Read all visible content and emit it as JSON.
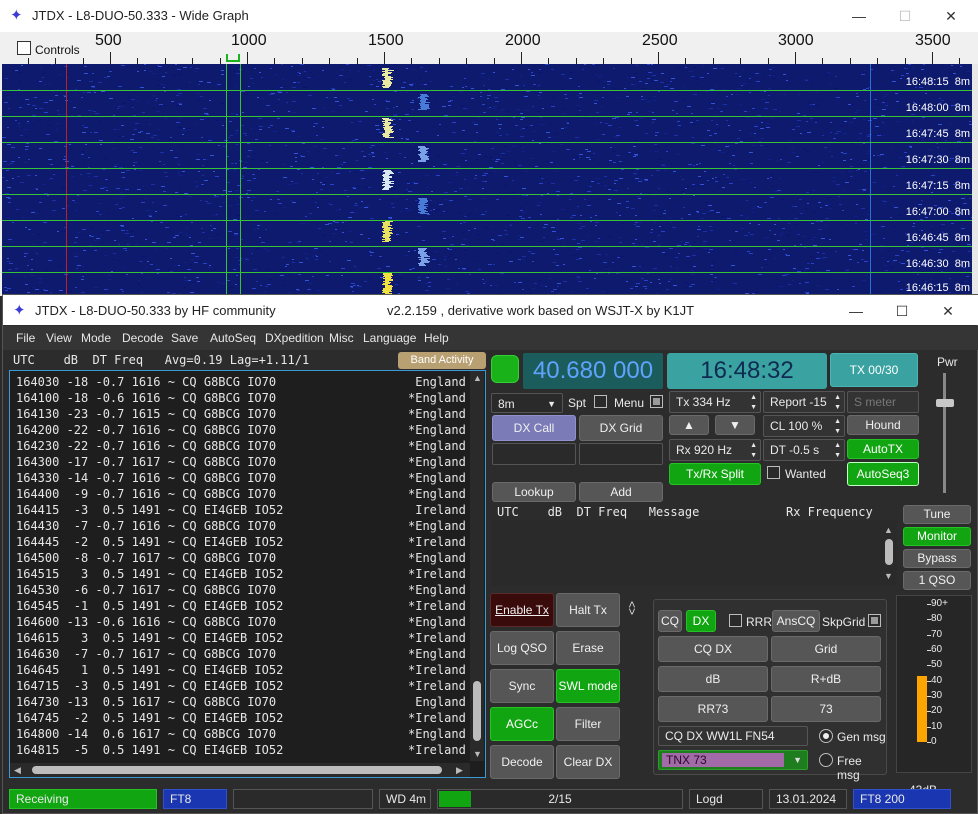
{
  "wide_graph": {
    "title": "JTDX - L8-DUO-50.333 - Wide Graph",
    "controls_label": "Controls",
    "scale_labels": [
      "500",
      "1000",
      "1500",
      "2000",
      "2500",
      "3000",
      "3500"
    ],
    "times": [
      "16:48:15",
      "16:48:00",
      "16:47:45",
      "16:47:30",
      "16:47:15",
      "16:47:00",
      "16:46:45",
      "16:46:30",
      "16:46:15"
    ],
    "band": "8m",
    "win_min": "—",
    "win_max": "☐",
    "win_close": "✕"
  },
  "main": {
    "title": "JTDX - L8-DUO-50.333   by HF community",
    "version": "v2.2.159 , derivative work based on WSJT-X by K1JT",
    "win_min": "—",
    "win_max": "☐",
    "win_close": "✕",
    "menu": [
      "File",
      "View",
      "Mode",
      "Decode",
      "Save",
      "AutoSeq",
      "DXpedition",
      "Misc",
      "Language",
      "Help"
    ]
  },
  "band_activity": {
    "header": "UTC    dB  DT Freq   Avg=0.19 Lag=+1.11/1",
    "button": "Band Activity",
    "rows": [
      {
        "t": "164030 -18 -0.7 1616 ~ CQ G8BCG IO70",
        "c": " England"
      },
      {
        "t": "164100 -18 -0.6 1616 ~ CQ G8BCG IO70",
        "c": "*England"
      },
      {
        "t": "164130 -23 -0.7 1615 ~ CQ G8BCG IO70",
        "c": "*England"
      },
      {
        "t": "164200 -22 -0.7 1616 ~ CQ G8BCG IO70",
        "c": "*England"
      },
      {
        "t": "164230 -22 -0.7 1616 ~ CQ G8BCG IO70",
        "c": "*England"
      },
      {
        "t": "164300 -17 -0.7 1617 ~ CQ G8BCG IO70",
        "c": "*England"
      },
      {
        "t": "164330 -14 -0.7 1616 ~ CQ G8BCG IO70",
        "c": "*England"
      },
      {
        "t": "164400  -9 -0.7 1616 ~ CQ G8BCG IO70",
        "c": "*England"
      },
      {
        "t": "164415  -3  0.5 1491 ~ CQ EI4GEB IO52",
        "c": " Ireland"
      },
      {
        "t": "164430  -7 -0.7 1616 ~ CQ G8BCG IO70",
        "c": "*England"
      },
      {
        "t": "164445  -2  0.5 1491 ~ CQ EI4GEB IO52",
        "c": "*Ireland"
      },
      {
        "t": "164500  -8 -0.7 1617 ~ CQ G8BCG IO70",
        "c": "*England"
      },
      {
        "t": "164515   3  0.5 1491 ~ CQ EI4GEB IO52",
        "c": "*Ireland"
      },
      {
        "t": "164530  -6 -0.7 1617 ~ CQ G8BCG IO70",
        "c": "*England"
      },
      {
        "t": "164545  -1  0.5 1491 ~ CQ EI4GEB IO52",
        "c": "*Ireland"
      },
      {
        "t": "164600 -13 -0.6 1616 ~ CQ G8BCG IO70",
        "c": "*England"
      },
      {
        "t": "164615   3  0.5 1491 ~ CQ EI4GEB IO52",
        "c": "*Ireland"
      },
      {
        "t": "164630  -7 -0.7 1617 ~ CQ G8BCG IO70",
        "c": "*England"
      },
      {
        "t": "164645   1  0.5 1491 ~ CQ EI4GEB IO52",
        "c": "*Ireland"
      },
      {
        "t": "164715  -3  0.5 1491 ~ CQ EI4GEB IO52",
        "c": "*Ireland"
      },
      {
        "t": "164730 -13  0.5 1617 ~ CQ G8BCG IO70",
        "c": " England"
      },
      {
        "t": "164745  -2  0.5 1491 ~ CQ EI4GEB IO52",
        "c": "*Ireland"
      },
      {
        "t": "164800 -14  0.6 1617 ~ CQ G8BCG IO70",
        "c": "*England"
      },
      {
        "t": "164815  -5  0.5 1491 ~ CQ EI4GEB IO52",
        "c": "*Ireland"
      }
    ]
  },
  "controls": {
    "frequency": "40.680 000",
    "clock": "16:48:32",
    "tx_counter": "TX 00/30",
    "pwr_label": "Pwr",
    "band": "8m",
    "spt_label": "Spt",
    "menu_label": "Menu",
    "dx_call": "DX Call",
    "dx_grid": "DX Grid",
    "lookup": "Lookup",
    "add": "Add",
    "tx_hz": "Tx  334  Hz",
    "rx_hz": "Rx  920  Hz",
    "report": "Report -15",
    "s_meter": "S meter",
    "cl": "CL  100 %",
    "dt": "DT -0.5 s",
    "hound": "Hound",
    "autotx": "AutoTX",
    "autoseq3": "AutoSeq3",
    "tx_rx_split": "Tx/Rx Split",
    "wanted": "Wanted",
    "up_arrow": "▲",
    "down_arrow": "▼"
  },
  "rx_frequency": {
    "header": "UTC    dB  DT Freq   Message            Rx Frequency"
  },
  "side_buttons": {
    "tune": "Tune",
    "monitor": "Monitor",
    "bypass": "Bypass",
    "one_qso": "1 QSO"
  },
  "action_buttons": {
    "enable_tx": "Enable Tx",
    "halt_tx": "Halt Tx",
    "log_qso": "Log QSO",
    "erase": "Erase",
    "sync": "Sync",
    "swl_mode": "SWL mode",
    "agcc": "AGCc",
    "filter": "Filter",
    "decode": "Decode",
    "clear_dx": "Clear DX",
    "arrows": "<>"
  },
  "tx_panel": {
    "cq": "CQ",
    "dx": "DX",
    "rrr": "RRR",
    "anscq": "AnsCQ",
    "skpgrid": "SkpGrid",
    "cq_dx": "CQ DX",
    "grid": "Grid",
    "db": "dB",
    "r_db": "R+dB",
    "rr73": "RR73",
    "b73": "73",
    "gen_text": "CQ DX WW1L FN54",
    "free_text": "TNX 73",
    "gen_msg": "Gen msg",
    "free_msg": "Free msg"
  },
  "meter": {
    "ticks": [
      "90+",
      "80",
      "70",
      "60",
      "50",
      "40",
      "30",
      "20",
      "10",
      "0"
    ],
    "value_db": 43,
    "value_label": "43dB"
  },
  "status": {
    "receiving": "Receiving",
    "mode": "FT8",
    "wd": "WD 4m",
    "progress": "2/15",
    "progress_value": 2,
    "progress_max": 15,
    "logd": "Logd",
    "date": "13.01.2024",
    "mode_freq": "FT8  200"
  },
  "colors": {
    "waterfall_bg": "#0d1a6e",
    "accent_green": "#12a512",
    "teal": "#3aa2a0",
    "status_blue": "#1a36b0",
    "enable_tx_red": "#3a0b0b",
    "meter_orange": "#ffa500",
    "free_msg_purple": "#a36aa8"
  }
}
